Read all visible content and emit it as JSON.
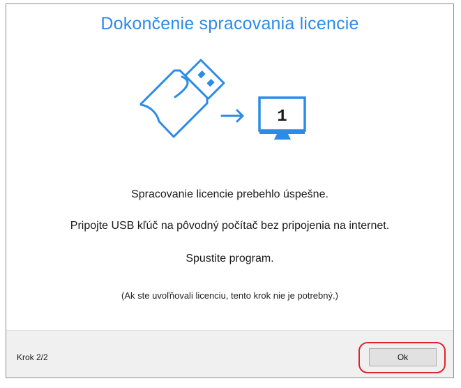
{
  "dialog": {
    "title": "Dokončenie spracovania licencie",
    "illustration": {
      "usb": "usb-key-icon",
      "arrow": "arrow-right-icon",
      "monitor": "monitor-icon",
      "monitor_number": "1"
    },
    "messages": {
      "success": "Spracovanie licencie prebehlo úspešne.",
      "connect": "Pripojte USB kľúč na pôvodný počítač bez pripojenia na internet.",
      "run": "Spustite program.",
      "note": "(Ak ste uvoľňovali licenciu, tento krok nie je potrebný.)"
    }
  },
  "footer": {
    "step": "Krok 2/2",
    "ok_label": "Ok"
  },
  "colors": {
    "accent": "#2b8be8",
    "highlight": "#e0242b",
    "footer_bg": "#f0f0f0"
  }
}
